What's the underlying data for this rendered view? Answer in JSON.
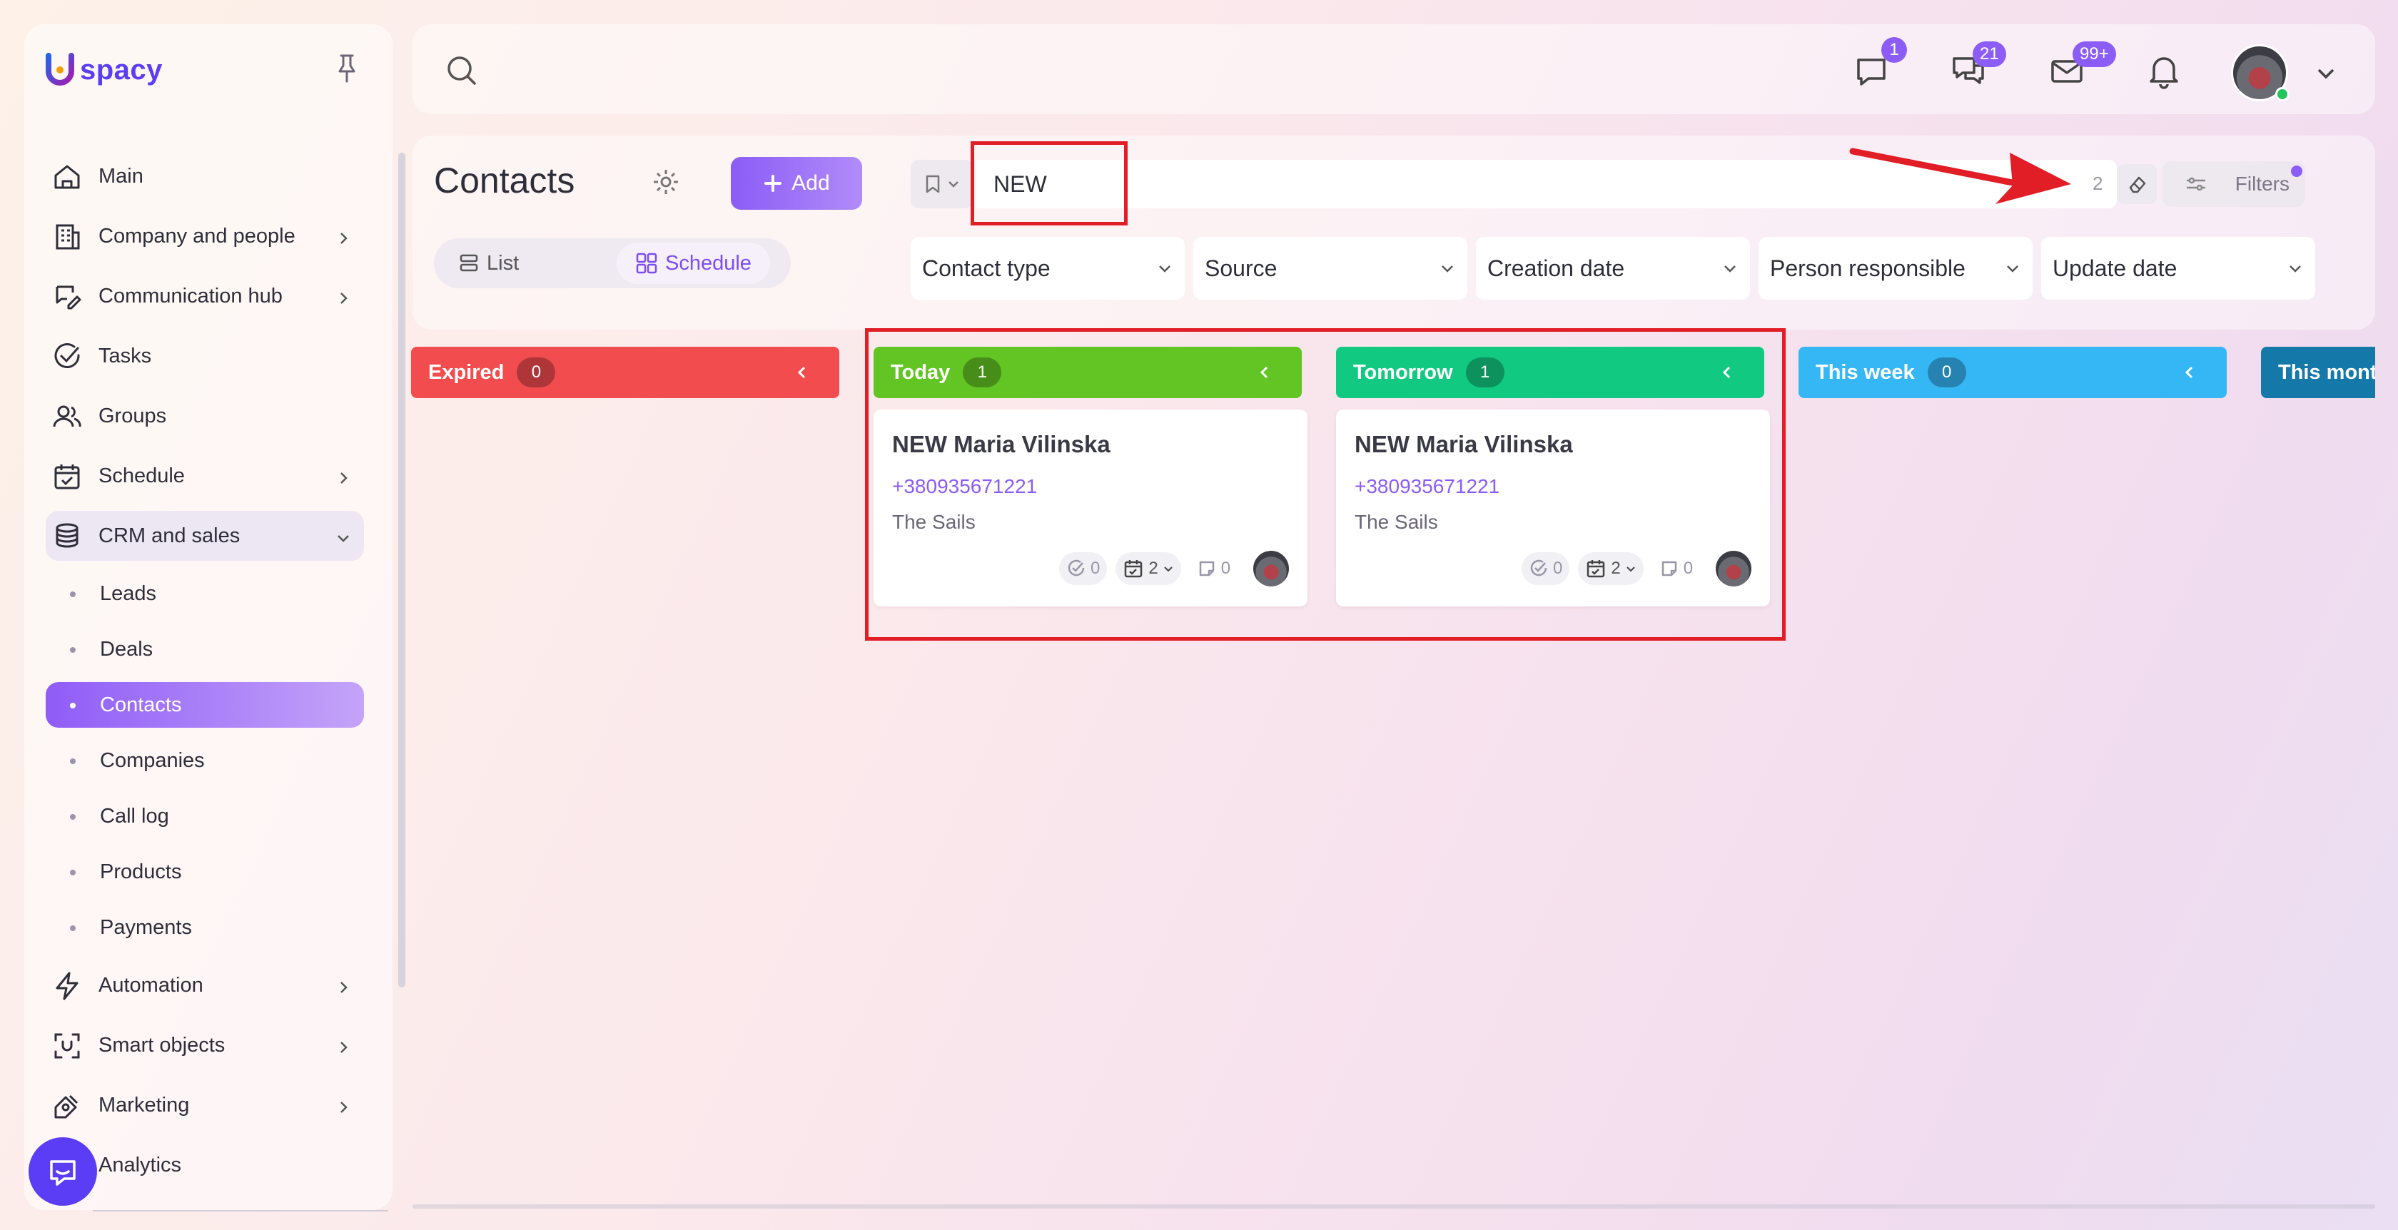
{
  "brand": {
    "logo_text": "spacy"
  },
  "sidebar": {
    "items": [
      {
        "label": "Main",
        "icon": "home-icon",
        "has_children": false
      },
      {
        "label": "Company and people",
        "icon": "building-icon",
        "has_children": true
      },
      {
        "label": "Communication hub",
        "icon": "chat-edit-icon",
        "has_children": true
      },
      {
        "label": "Tasks",
        "icon": "check-circle-icon",
        "has_children": false
      },
      {
        "label": "Groups",
        "icon": "users-icon",
        "has_children": false
      },
      {
        "label": "Schedule",
        "icon": "calendar-check-icon",
        "has_children": true
      },
      {
        "label": "CRM and sales",
        "icon": "database-icon",
        "has_children": true,
        "expanded": true
      }
    ],
    "crm_sub_items": [
      "Leads",
      "Deals",
      "Contacts",
      "Companies",
      "Call log",
      "Products",
      "Payments"
    ],
    "crm_active": "Contacts",
    "items_after": [
      {
        "label": "Automation",
        "icon": "lightning-icon"
      },
      {
        "label": "Smart objects",
        "icon": "scan-icon"
      },
      {
        "label": "Marketing",
        "icon": "megaphone-icon"
      },
      {
        "label": "Analytics",
        "icon": "chart-icon"
      }
    ]
  },
  "topbar": {
    "messages_badge": "1",
    "chats_badge": "21",
    "mail_badge": "99+"
  },
  "contacts": {
    "title": "Contacts",
    "add_label": "Add",
    "view_list_label": "List",
    "view_schedule_label": "Schedule",
    "search_value": "NEW",
    "found_count": "2",
    "filters_label": "Filters",
    "filter_selects": [
      "Contact type",
      "Source",
      "Creation date",
      "Person responsible",
      "Update date"
    ]
  },
  "board": {
    "columns": [
      {
        "label": "Expired",
        "count": "0",
        "color": "#f24c4f"
      },
      {
        "label": "Today",
        "count": "1",
        "color": "#62c523"
      },
      {
        "label": "Tomorrow",
        "count": "1",
        "color": "#12c982"
      },
      {
        "label": "This week",
        "count": "0",
        "color": "#35b6f5"
      },
      {
        "label": "This mont",
        "count": "",
        "color": "#1478a8"
      }
    ],
    "cards": [
      {
        "name": "NEW Maria Vilinska",
        "phone": "+380935671221",
        "company": "The Sails",
        "tasks": "0",
        "events": "2",
        "notes": "0"
      },
      {
        "name": "NEW Maria Vilinska",
        "phone": "+380935671221",
        "company": "The Sails",
        "tasks": "0",
        "events": "2",
        "notes": "0"
      }
    ]
  },
  "colors": {
    "accent": "#8b5cf6",
    "highlight": "#e11d26"
  }
}
